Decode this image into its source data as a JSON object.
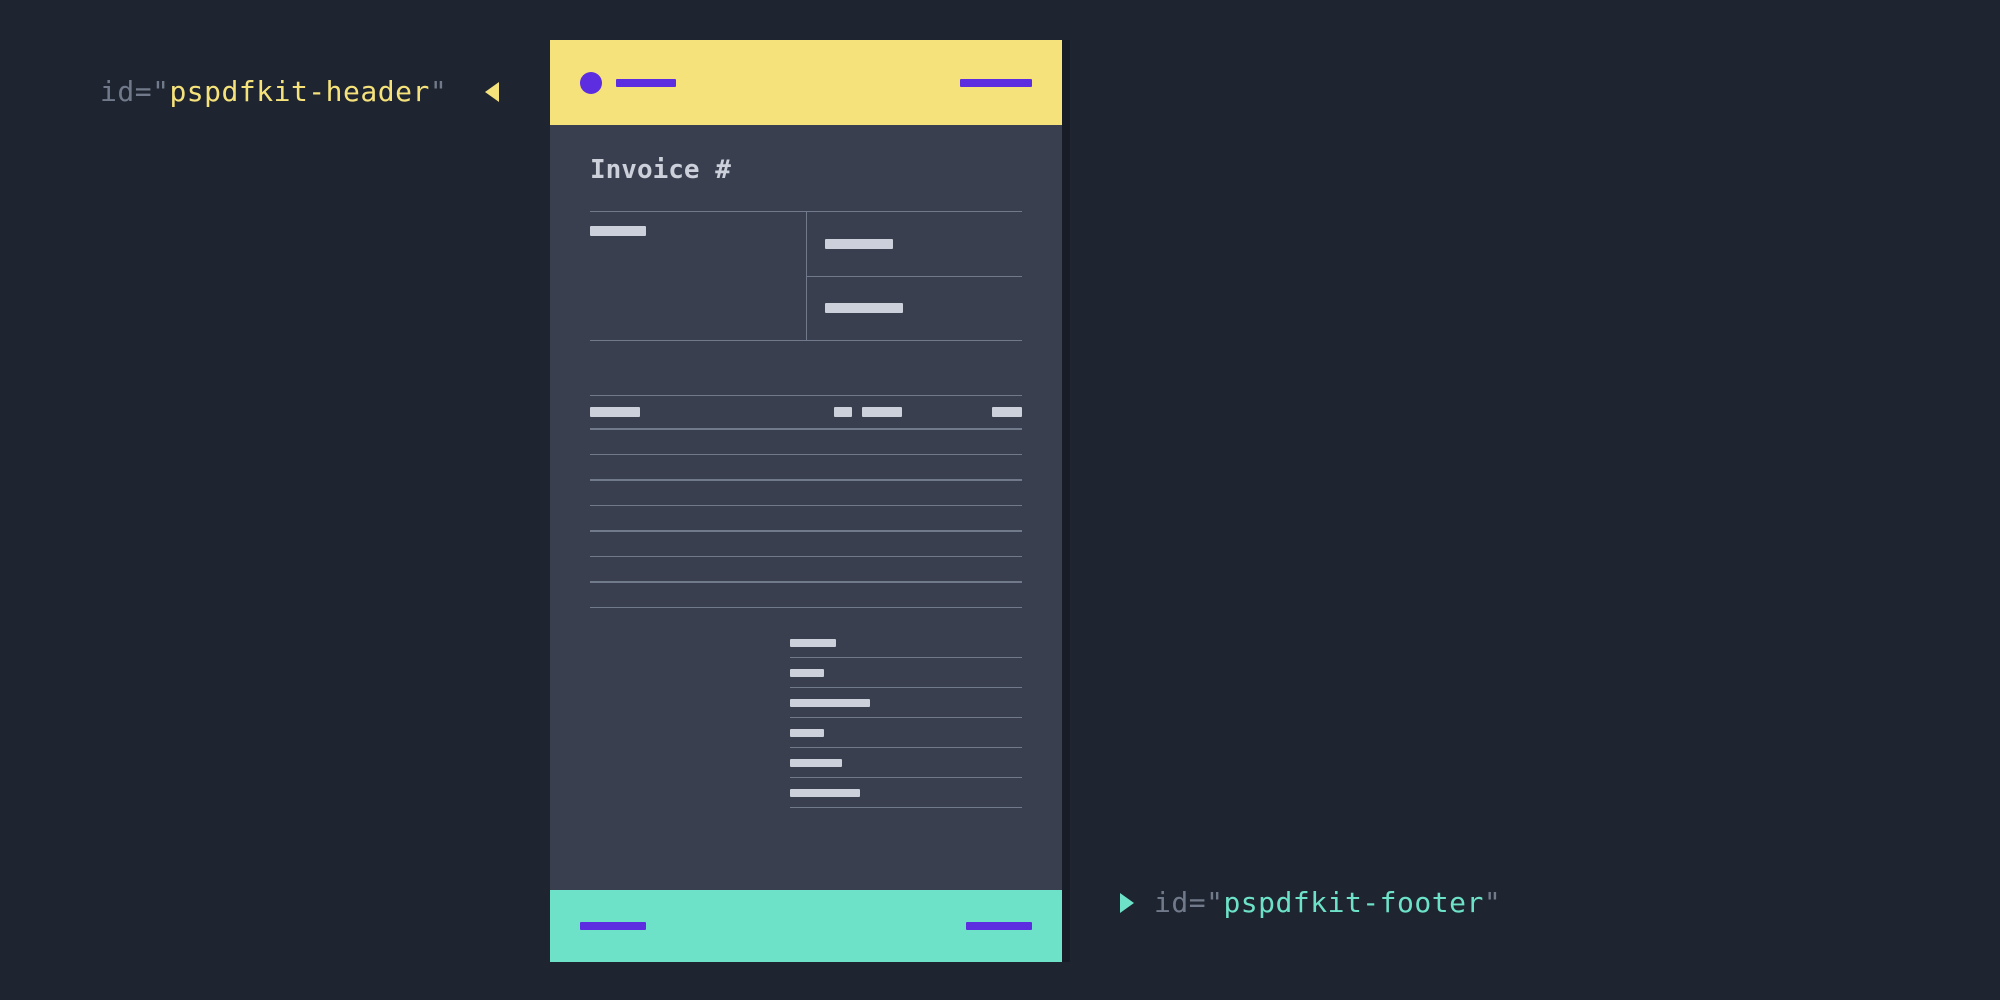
{
  "annotations": {
    "header": {
      "key": "id",
      "eq": "=",
      "q": "\"",
      "value": "pspdfkit-header"
    },
    "footer": {
      "key": "id",
      "eq": "=",
      "q": "\"",
      "value": "pspdfkit-footer"
    }
  },
  "document": {
    "title": "Invoice #"
  },
  "colors": {
    "header_bg": "#f5e27b",
    "footer_bg": "#6de2c9",
    "accent": "#5d2de0",
    "body_bg": "#3a3f50",
    "page_bg": "#1e2430"
  }
}
